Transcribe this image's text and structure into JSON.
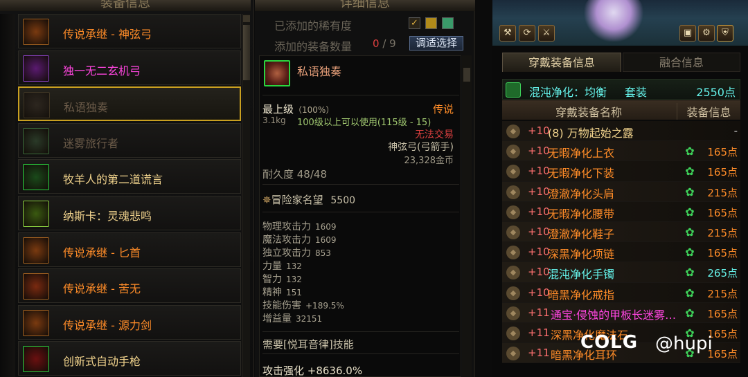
{
  "left_panel": {
    "title": "装备信息",
    "items": [
      {
        "name": "传说承继 - 神弦弓",
        "color": "#ff8c28",
        "icon": "bow-icon",
        "selected": false
      },
      {
        "name": "独一无二玄机弓",
        "color": "#ff45e0",
        "icon": "bow-icon",
        "selected": false
      },
      {
        "name": "私语独奏",
        "color": "#6a5a48",
        "icon": "bow-icon",
        "selected": true
      },
      {
        "name": "迷雾旅行者",
        "color": "#6a5a48",
        "icon": "bow-icon",
        "selected": false
      },
      {
        "name": "牧羊人的第二道谎言",
        "color": "#f0d28c",
        "icon": "weapon-icon",
        "selected": false
      },
      {
        "name": "纳斯卡：灵魂悲鸣",
        "color": "#f0d28c",
        "icon": "weapon-icon",
        "selected": false
      },
      {
        "name": "传说承继 - 匕首",
        "color": "#ff8c28",
        "icon": "dagger-icon",
        "selected": false
      },
      {
        "name": "传说承继 - 苦无",
        "color": "#ff8c28",
        "icon": "kunai-icon",
        "selected": false
      },
      {
        "name": "传说承继 - 源力剑",
        "color": "#ff8c28",
        "icon": "sword-icon",
        "selected": false
      },
      {
        "name": "创新式自动手枪",
        "color": "#f0d28c",
        "icon": "pistol-icon",
        "selected": false
      }
    ]
  },
  "mid_panel": {
    "title": "详细信息",
    "added_rarity_label": "已添加的稀有度",
    "added_count_label": "添加的装备数量",
    "added_count": "0",
    "added_total": "/ 9",
    "adjust_button": "调适选择",
    "item": {
      "name": "私语独奏",
      "grade": "最上级",
      "grade_pct": "（100%）",
      "rarity": "传说",
      "weight": "3.1kg",
      "level_req": "100级以上可以使用(115级 - 15)",
      "trade": "无法交易",
      "type": "神弦弓(弓箭手)",
      "price": "23,328金币",
      "durability": "耐久度  48/48",
      "fame_label": "冒险家名望",
      "fame_value": "5500",
      "stats": [
        {
          "label": "物理攻击力",
          "value": "1609"
        },
        {
          "label": "魔法攻击力",
          "value": "1609"
        },
        {
          "label": "独立攻击力",
          "value": "853"
        },
        {
          "label": "力量",
          "value": "132"
        },
        {
          "label": "智力",
          "value": "132"
        },
        {
          "label": "精神",
          "value": "151"
        },
        {
          "label": "技能伤害",
          "value": "+189.5%"
        },
        {
          "label": "增益量",
          "value": "32151"
        }
      ],
      "skill_req": "需要[悦耳音律]技能",
      "attack_boost": "攻击强化 +8636.0%"
    }
  },
  "right_panel": {
    "tab_active": "穿戴装备信息",
    "tab_inactive": "融合信息",
    "set_name": "混沌净化：均衡",
    "set_tag": "套装",
    "set_points": "2550点",
    "col_name": "穿戴装备名称",
    "col_info": "装备信息",
    "rows": [
      {
        "slot": "weapon-slot-icon",
        "level": "+10",
        "name": "(8) 万物起始之露",
        "name_color": "#f0d28c",
        "points": "-",
        "points_color": "#d0d0d0",
        "badge": false
      },
      {
        "slot": "top-slot-icon",
        "level": "+10",
        "name": "无暇净化上衣",
        "name_color": "#ff8c28",
        "points": "165点",
        "points_color": "#ff8c28",
        "badge": true
      },
      {
        "slot": "pants-slot-icon",
        "level": "+10",
        "name": "无暇净化下装",
        "name_color": "#ff8c28",
        "points": "165点",
        "points_color": "#ff8c28",
        "badge": true
      },
      {
        "slot": "shoulder-slot-icon",
        "level": "+10",
        "name": "澄澈净化头肩",
        "name_color": "#ff8c28",
        "points": "215点",
        "points_color": "#ff8c28",
        "badge": true
      },
      {
        "slot": "belt-slot-icon",
        "level": "+10",
        "name": "无暇净化腰带",
        "name_color": "#ff8c28",
        "points": "165点",
        "points_color": "#ff8c28",
        "badge": true
      },
      {
        "slot": "shoes-slot-icon",
        "level": "+10",
        "name": "澄澈净化鞋子",
        "name_color": "#ff8c28",
        "points": "215点",
        "points_color": "#ff8c28",
        "badge": true
      },
      {
        "slot": "necklace-slot-icon",
        "level": "+10",
        "name": "深黑净化项链",
        "name_color": "#ff8c28",
        "points": "165点",
        "points_color": "#ff8c28",
        "badge": true
      },
      {
        "slot": "bracelet-slot-icon",
        "level": "+10",
        "name": "混沌净化手镯",
        "name_color": "#64f0e8",
        "points": "265点",
        "points_color": "#64f0e8",
        "badge": true
      },
      {
        "slot": "ring-slot-icon",
        "level": "+10",
        "name": "暗黑净化戒指",
        "name_color": "#ff8c28",
        "points": "215点",
        "points_color": "#ff8c28",
        "badge": true
      },
      {
        "slot": "sub-slot-icon",
        "level": "+11",
        "name": "通宝·侵蚀的甲板长迷雾…",
        "name_color": "#ff45e0",
        "points": "165点",
        "points_color": "#ff8c28",
        "badge": true
      },
      {
        "slot": "stone-slot-icon",
        "level": "+11",
        "name": "深黑净化魔法石",
        "name_color": "#ff8c28",
        "points": "165点",
        "points_color": "#ff8c28",
        "badge": true
      },
      {
        "slot": "earring-slot-icon",
        "level": "+11",
        "name": "暗黑净化耳环",
        "name_color": "#ff8c28",
        "points": "165点",
        "points_color": "#ff8c28",
        "badge": true
      }
    ]
  },
  "watermark": {
    "logo": "COLG",
    "handle": "@hupi"
  }
}
